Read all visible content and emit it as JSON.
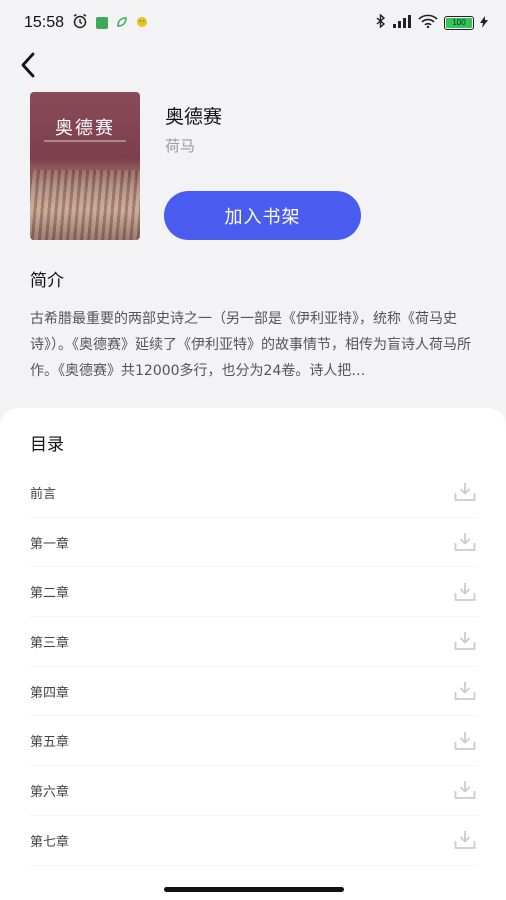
{
  "status_bar": {
    "time": "15:58",
    "battery_level": "100",
    "notification_icons": [
      "alarm-icon",
      "app-notification-icon",
      "leaf-icon",
      "smiley-icon"
    ],
    "system_icons": [
      "bluetooth-icon",
      "signal-icon",
      "wifi-icon",
      "battery-icon",
      "charging-icon"
    ],
    "colors": {
      "battery_fill": "#32c65a"
    }
  },
  "header": {
    "back_icon": "chevron-left-icon"
  },
  "book": {
    "title": "奥德赛",
    "author": "荷马",
    "cover": {
      "title": "奥德赛"
    },
    "add_to_shelf_label": "加入书架"
  },
  "intro": {
    "heading": "简介",
    "text": "古希腊最重要的两部史诗之一（另一部是《伊利亚特》，统称《荷马史诗》）。《奥德赛》延续了《伊利亚特》的故事情节，相传为盲诗人荷马所作。《奥德赛》共12000多行，也分为24卷。诗人把…"
  },
  "catalog": {
    "heading": "目录",
    "chapters": [
      {
        "name": "前言"
      },
      {
        "name": "第一章"
      },
      {
        "name": "第二章"
      },
      {
        "name": "第三章"
      },
      {
        "name": "第四章"
      },
      {
        "name": "第五章"
      },
      {
        "name": "第六章"
      },
      {
        "name": "第七章"
      }
    ],
    "download_icon": "download-icon"
  },
  "colors": {
    "accent": "#4a5cf0",
    "background": "#f3f3f6",
    "muted_text": "#9a9a9a",
    "icon_gray": "#cccccc"
  }
}
